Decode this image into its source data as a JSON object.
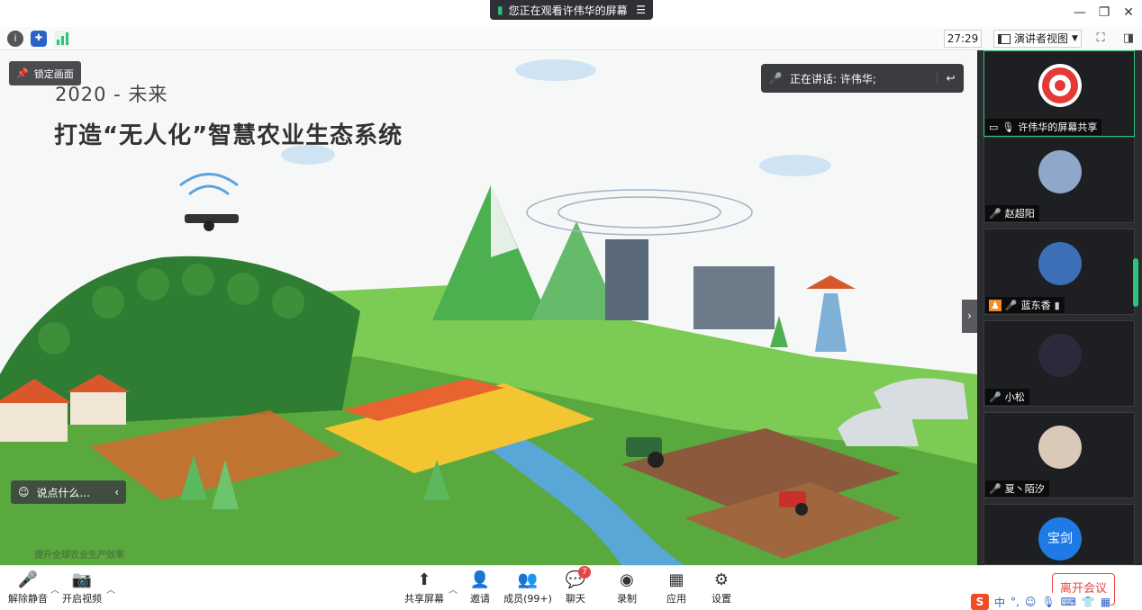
{
  "titlebar": {
    "share_label": "您正在观看许伟华的屏幕",
    "minimize_icon": "minimize-icon",
    "restore_icon": "restore-icon",
    "close_icon": "close-icon"
  },
  "toolbar": {
    "info_icon": "info-icon",
    "shield_icon": "shield-icon",
    "signal_icon": "signal-icon",
    "timer": "27:29",
    "view_mode": "演讲者视图",
    "fullscreen_icon": "fullscreen-icon",
    "panel_toggle_icon": "panel-toggle-icon"
  },
  "stage": {
    "lock_label": "锁定画面",
    "speaking_label": "正在讲话: 许伟华;",
    "chat_placeholder": "说点什么...",
    "slide_year": "2020 - 未来",
    "slide_title": "打造“无人化”智慧农业生态系统",
    "slide_footer": "提升全球农业生产效率"
  },
  "participants": [
    {
      "name": "许伟华的屏幕共享",
      "avatar_color": "#e8e8e8",
      "muted": false,
      "active": true,
      "sharing": true
    },
    {
      "name": "赵超阳",
      "avatar_color": "#8fa7c9",
      "muted": true,
      "active": false
    },
    {
      "name": "蓝东香",
      "avatar_color": "#3d6fb8",
      "muted": true,
      "active": false,
      "host": true
    },
    {
      "name": "小松",
      "avatar_color": "#2a2a3a",
      "muted": true,
      "active": false
    },
    {
      "name": "夏丶陌汐",
      "avatar_color": "#d9c9b8",
      "muted": true,
      "active": false
    },
    {
      "name": "宝剑",
      "avatar_color": "#1e7be6",
      "muted": false,
      "active": false
    }
  ],
  "bottombar": {
    "unmute": "解除静音",
    "start_video": "开启视频",
    "share_screen": "共享屏幕",
    "invite": "邀请",
    "members": "成员(99+)",
    "chat": "聊天",
    "chat_badge": "7",
    "record": "录制",
    "apps": "应用",
    "settings": "设置",
    "leave": "离开会议"
  },
  "ime": {
    "logo": "S",
    "mode": "中"
  },
  "colors": {
    "accent_green": "#2ec27e",
    "danger_red": "#e94545",
    "panel_bg": "#2b2c30"
  }
}
